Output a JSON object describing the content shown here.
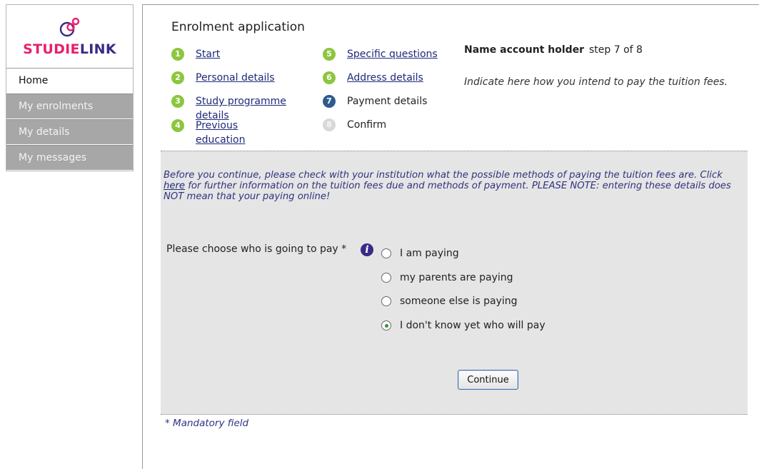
{
  "logo": {
    "text_a": "STUDIE",
    "text_b": "LINK"
  },
  "sidebar": {
    "items": [
      {
        "label": "Home"
      },
      {
        "label": "My enrolments"
      },
      {
        "label": "My details"
      },
      {
        "label": "My messages"
      }
    ]
  },
  "header": {
    "title": "Enrolment application",
    "account_holder": "Name account holder",
    "step_counter": "step 7 of 8",
    "instruction": "Indicate here how you intend to pay the tuition fees."
  },
  "steps": [
    {
      "num": "1",
      "label": "Start",
      "state": "done"
    },
    {
      "num": "2",
      "label": "Personal details",
      "state": "done"
    },
    {
      "num": "3",
      "label_line1": "Study programme",
      "label_line2": "details",
      "state": "done"
    },
    {
      "num": "4",
      "label_line1": "Previous",
      "label_line2": "education",
      "state": "done"
    },
    {
      "num": "5",
      "label": "Specific questions",
      "state": "done"
    },
    {
      "num": "6",
      "label": "Address details",
      "state": "done"
    },
    {
      "num": "7",
      "label": "Payment details",
      "state": "current"
    },
    {
      "num": "8",
      "label": "Confirm",
      "state": "upcoming"
    }
  ],
  "notice": {
    "part1": "Before you continue, please check with your institution what the possible methods of paying the tuition fees are. Click ",
    "link": "here",
    "part2": " for further information on the tuition fees due and methods of payment. PLEASE NOTE: entering these details does NOT mean that your paying online!"
  },
  "form": {
    "question": "Please choose who is going to pay *",
    "info_icon": "i",
    "options": [
      {
        "label": "I am paying",
        "checked": false
      },
      {
        "label": "my parents are paying",
        "checked": false
      },
      {
        "label": "someone else is paying",
        "checked": false
      },
      {
        "label": "I don't know yet who will pay",
        "checked": true
      }
    ],
    "continue_label": "Continue"
  },
  "footer": {
    "mandatory_note": "* Mandatory field"
  },
  "colors": {
    "brand_pink": "#e6206d",
    "brand_purple": "#3a2a86",
    "step_green": "#8cc63e",
    "step_current": "#2e5b8f"
  }
}
